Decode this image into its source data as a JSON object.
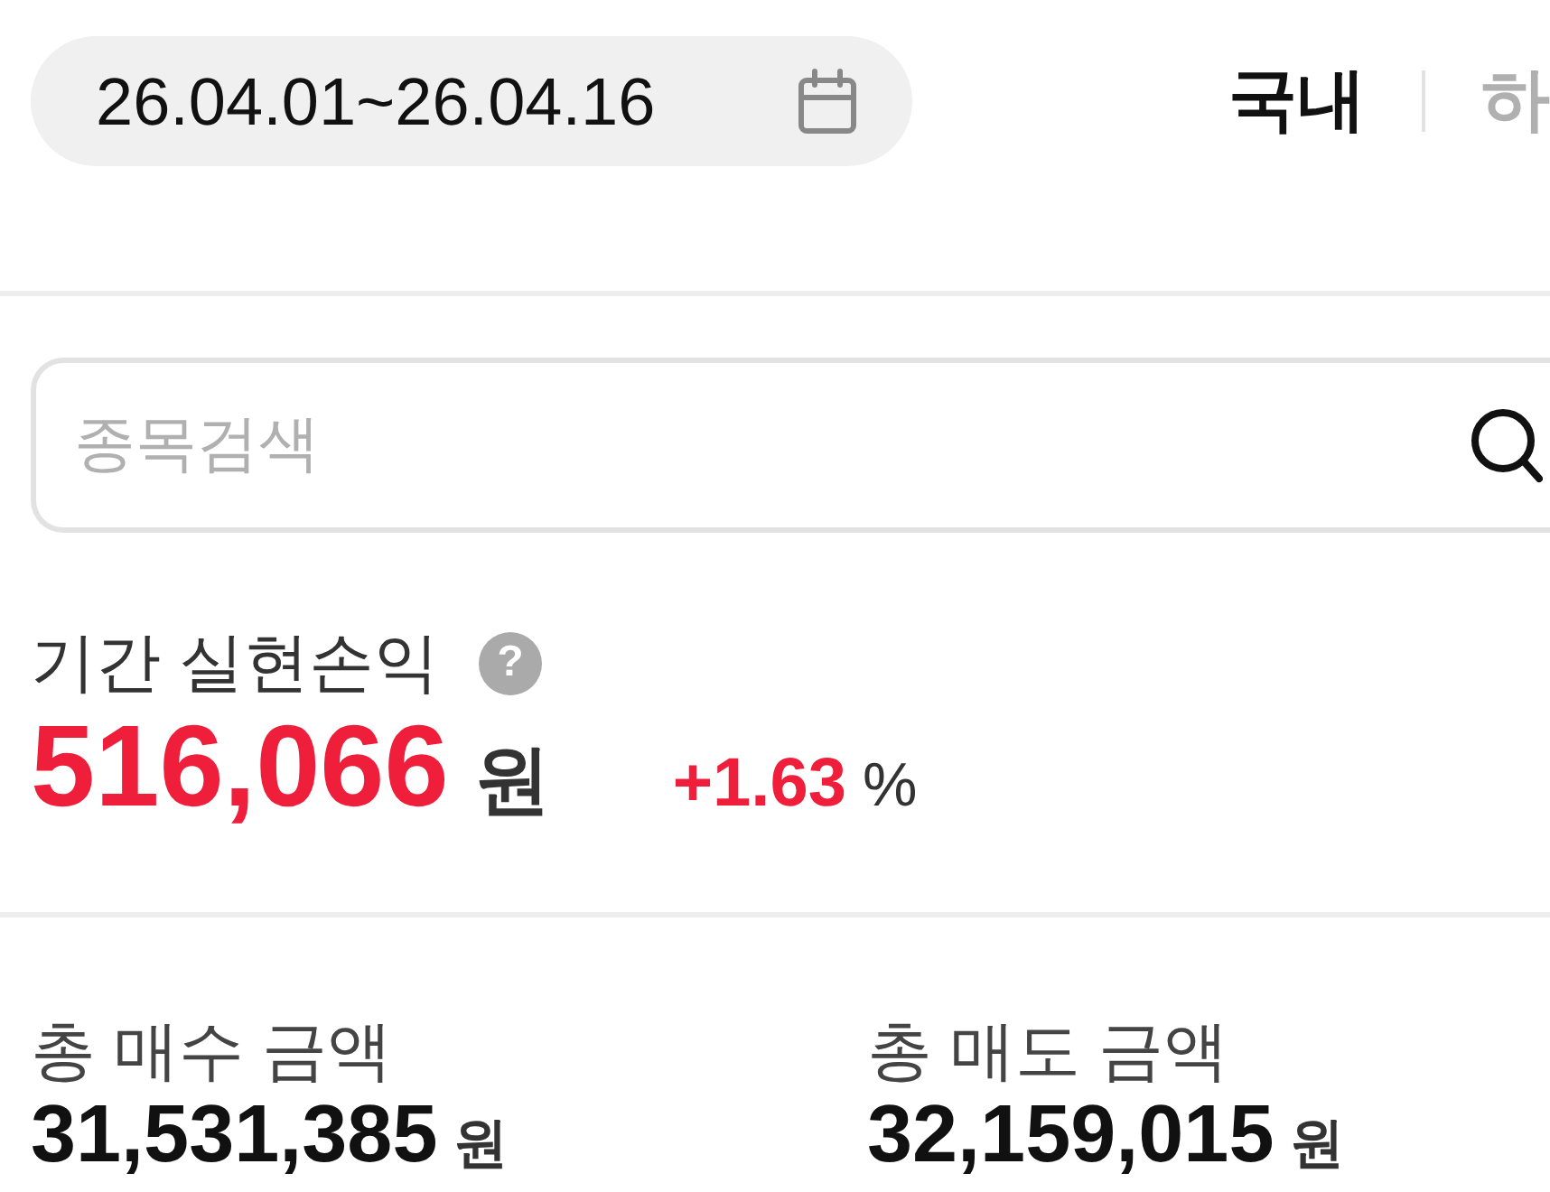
{
  "date_range": {
    "value": "26.04.01~26.04.16"
  },
  "market_tabs": [
    {
      "label": "국내",
      "selected": true
    },
    {
      "label": "하",
      "selected": false
    }
  ],
  "search": {
    "placeholder": "종목검색"
  },
  "realized_pnl": {
    "label": "기간 실현손익",
    "help": "?",
    "amount": "516,066",
    "unit": "원",
    "rate": "+1.63",
    "rate_unit": "%"
  },
  "totals": [
    {
      "label": "총 매수 금액",
      "amount": "31,531,385",
      "unit": "원"
    },
    {
      "label": "총 매도 금액",
      "amount": "32,159,015",
      "unit": "원"
    }
  ]
}
